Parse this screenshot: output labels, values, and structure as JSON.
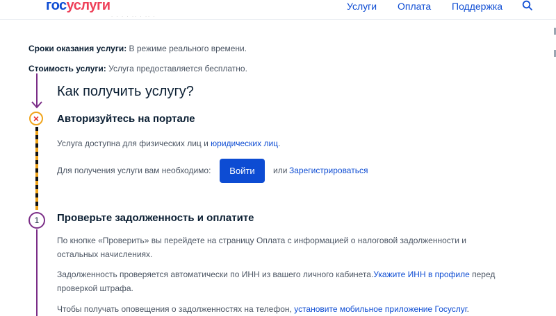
{
  "header": {
    "logo_part1": "гос",
    "logo_part2": "услуги",
    "nav": {
      "services": "Услуги",
      "payment": "Оплата",
      "support": "Поддержка"
    }
  },
  "info": {
    "terms_label": "Сроки оказания услуги:",
    "terms_value": "В режиме реального времени.",
    "cost_label": "Стоимость услуги:",
    "cost_value": "Услуга предоставляется бесплатно."
  },
  "main": {
    "heading": "Как получить услугу?",
    "step_auth": {
      "title": "Авторизуйтесь на портале",
      "text_prefix": "Услуга доступна для физических лиц и",
      "text_link": "юридических лиц",
      "text_suffix": ".",
      "login_prompt": "Для получения услуги вам необходимо:",
      "login_button": "Войти",
      "or_text": "или",
      "register_link": "Зарегистрироваться"
    },
    "step_1": {
      "number": "1",
      "title": "Проверьте задолженность и оплатите",
      "paragraph1_line1": "По кнопке «Проверить» вы перейдете на страницу Оплата с информацией о налоговой задолженности и",
      "paragraph1_line2": "остальных начислениях.",
      "paragraph2_text": "Задолженность проверяется автоматически по ИНН из вашего личного кабинета.",
      "paragraph2_link": "Укажите ИНН в профиле",
      "paragraph2_suffix": " перед",
      "paragraph2_line2": "проверкой штрафа.",
      "paragraph3_text": "Чтобы получать оповещения о задолженностях на телефон, ",
      "paragraph3_link": "установите мобильное приложение Госуслуг",
      "paragraph3_suffix": "."
    }
  },
  "colors": {
    "brand_blue": "#0d4cd3",
    "brand_red": "#ee3f58",
    "step_purple": "#7b2e87",
    "warning_orange": "#f0a41b",
    "error_red": "#e8302b"
  },
  "icons": {
    "search": "search-icon",
    "error": "close-icon",
    "arrow": "arrow-down-icon"
  }
}
